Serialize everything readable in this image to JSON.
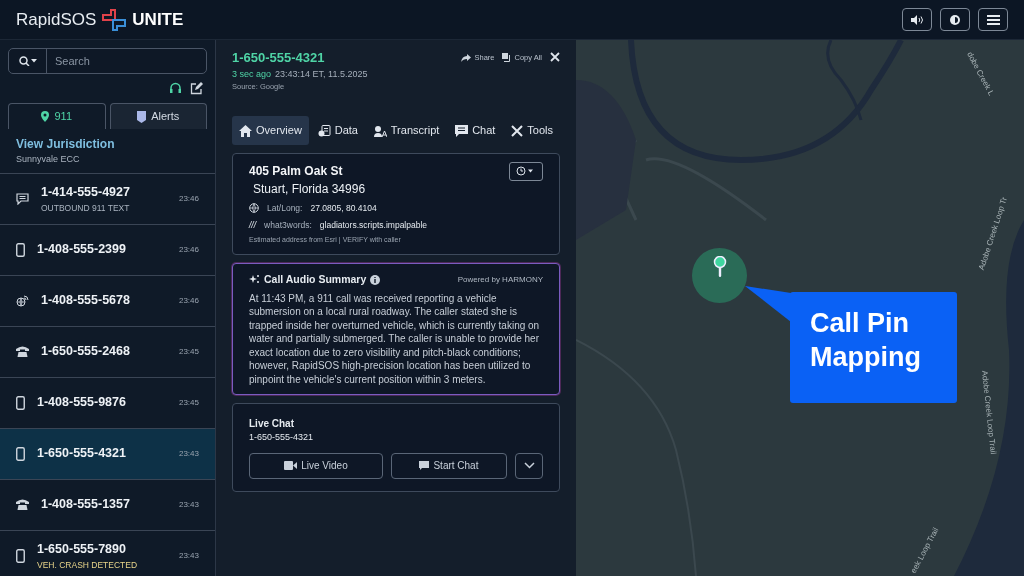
{
  "header": {
    "brand_left": "RapidSOS",
    "brand_right": "UNITE"
  },
  "sidebar": {
    "search": {
      "placeholder": "Search"
    },
    "tabs": [
      {
        "label": "911",
        "selected": true
      },
      {
        "label": "Alerts",
        "selected": false
      }
    ],
    "jurisdiction": {
      "title": "View Jurisdiction",
      "subtitle": "Sunnyvale ECC"
    },
    "calls": [
      {
        "kind": "text",
        "number": "1-414-555-4927",
        "subtitle": "OUTBOUND 911 TEXT",
        "color": "#aab4c0",
        "time": "23:46",
        "selected": false
      },
      {
        "kind": "mobile",
        "number": "1-408-555-2399",
        "time": "23:46",
        "selected": false
      },
      {
        "kind": "voip",
        "number": "1-408-555-5678",
        "time": "23:46",
        "selected": false
      },
      {
        "kind": "landline",
        "number": "1-650-555-2468",
        "time": "23:45",
        "selected": false
      },
      {
        "kind": "mobile",
        "number": "1-408-555-9876",
        "time": "23:45",
        "selected": false
      },
      {
        "kind": "mobile",
        "number": "1-650-555-4321",
        "time": "23:43",
        "selected": true
      },
      {
        "kind": "landline",
        "number": "1-408-555-1357",
        "time": "23:43",
        "selected": false
      },
      {
        "kind": "mobile",
        "number": "1-650-555-7890",
        "subtitle": "VEH. CRASH DETECTED",
        "color": "#e8d48a",
        "time": "23:43",
        "selected": false
      }
    ]
  },
  "detail": {
    "number": "1-650-555-4321",
    "ago": "3 sec ago",
    "timestamp": "23:43:14 ET, 11.5.2025",
    "source": "Source: Google",
    "actions": [
      {
        "kind": "share",
        "label": "Share"
      },
      {
        "kind": "copy",
        "label": "Copy All"
      }
    ],
    "tabs": [
      {
        "kind": "overview",
        "label": "Overview",
        "selected": true
      },
      {
        "kind": "data",
        "label": "Data",
        "selected": false
      },
      {
        "kind": "transcript",
        "label": "Transcript",
        "selected": false
      },
      {
        "kind": "chat",
        "label": "Chat",
        "selected": false
      },
      {
        "kind": "tools",
        "label": "Tools",
        "selected": false
      }
    ],
    "location": {
      "street": "405 Palm Oak St",
      "city": "Stuart, Florida 34996",
      "latlong_label": "Lat/Long:",
      "latlong": "27.0805, 80.4104",
      "w3w_mark": "///",
      "w3w_label": "what3words:",
      "w3w": "gladiators.scripts.impalpable",
      "note": "Estimated address from Esri | VERIFY with caller"
    },
    "summary": {
      "title": "Call Audio Summary",
      "powered": "Powered by HARMONY",
      "text": "At 11:43 PM, a 911 call was received reporting a vehicle submersion on a local rural roadway. The caller stated she is trapped inside her overturned vehicle, which is currently taking on water and partially submerged. The caller is unable to provide her exact location due to zero visibility and pitch-black conditions; however, RapidSOS high-precision location has been utilized to pinpoint the vehicle's current position within 3 meters."
    },
    "live_chat": {
      "title": "Live Chat",
      "number": "1-650-555-4321",
      "buttons": [
        {
          "kind": "video",
          "label": "Live Video"
        },
        {
          "kind": "chat",
          "label": "Start Chat"
        }
      ]
    }
  },
  "map": {
    "callout": "Call Pin Mapping",
    "labels": [
      "dobe Creek L",
      "Adobe Creek Loop Tr",
      "Adobe Creek Loop Trail",
      "eek Loop Trail"
    ]
  }
}
